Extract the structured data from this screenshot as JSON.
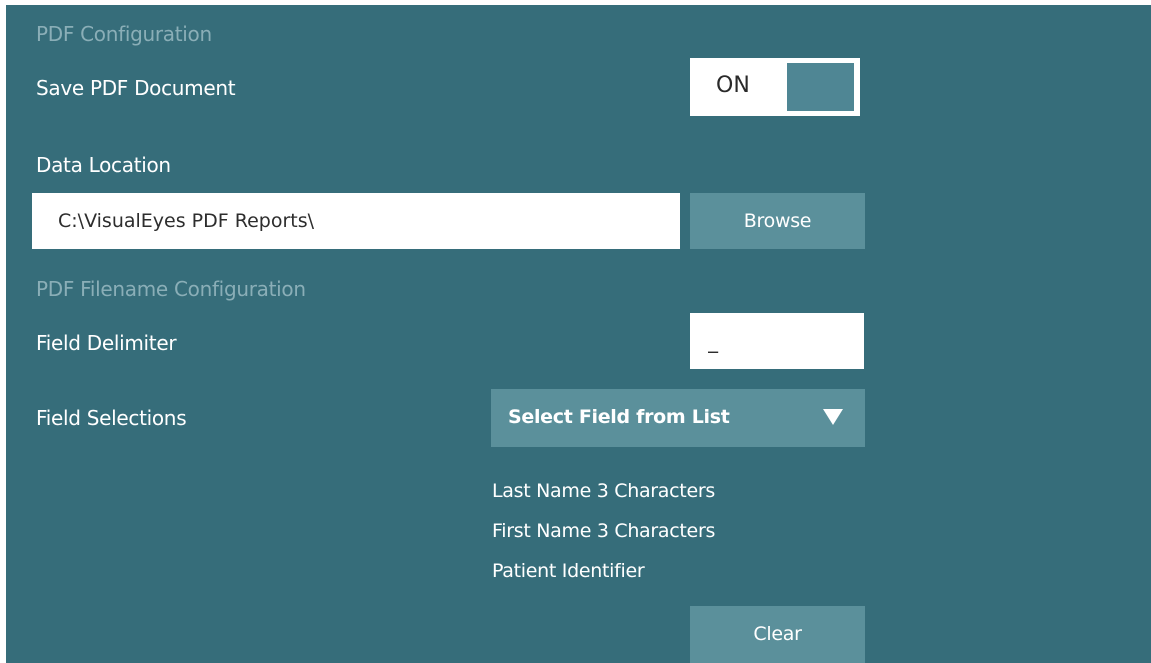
{
  "pdf_config": {
    "section_title": "PDF Configuration",
    "save_pdf_label": "Save PDF Document",
    "save_pdf_toggle": "ON",
    "data_location_label": "Data Location",
    "data_location_value": "C:\\VisualEyes PDF Reports\\",
    "browse_label": "Browse"
  },
  "filename_config": {
    "section_title": "PDF Filename Configuration",
    "field_delimiter_label": "Field Delimiter",
    "field_delimiter_value": "_",
    "field_selections_label": "Field Selections",
    "field_dropdown_selected": "Select Field from List",
    "selected_fields": [
      "Last Name 3 Characters",
      "First Name 3 Characters",
      "Patient Identifier"
    ],
    "clear_label": "Clear"
  },
  "colors": {
    "panel_background": "#366d7a",
    "button_background": "#5b909b",
    "section_title": "#8aaeb7",
    "toggle_knob": "#4f8694"
  }
}
